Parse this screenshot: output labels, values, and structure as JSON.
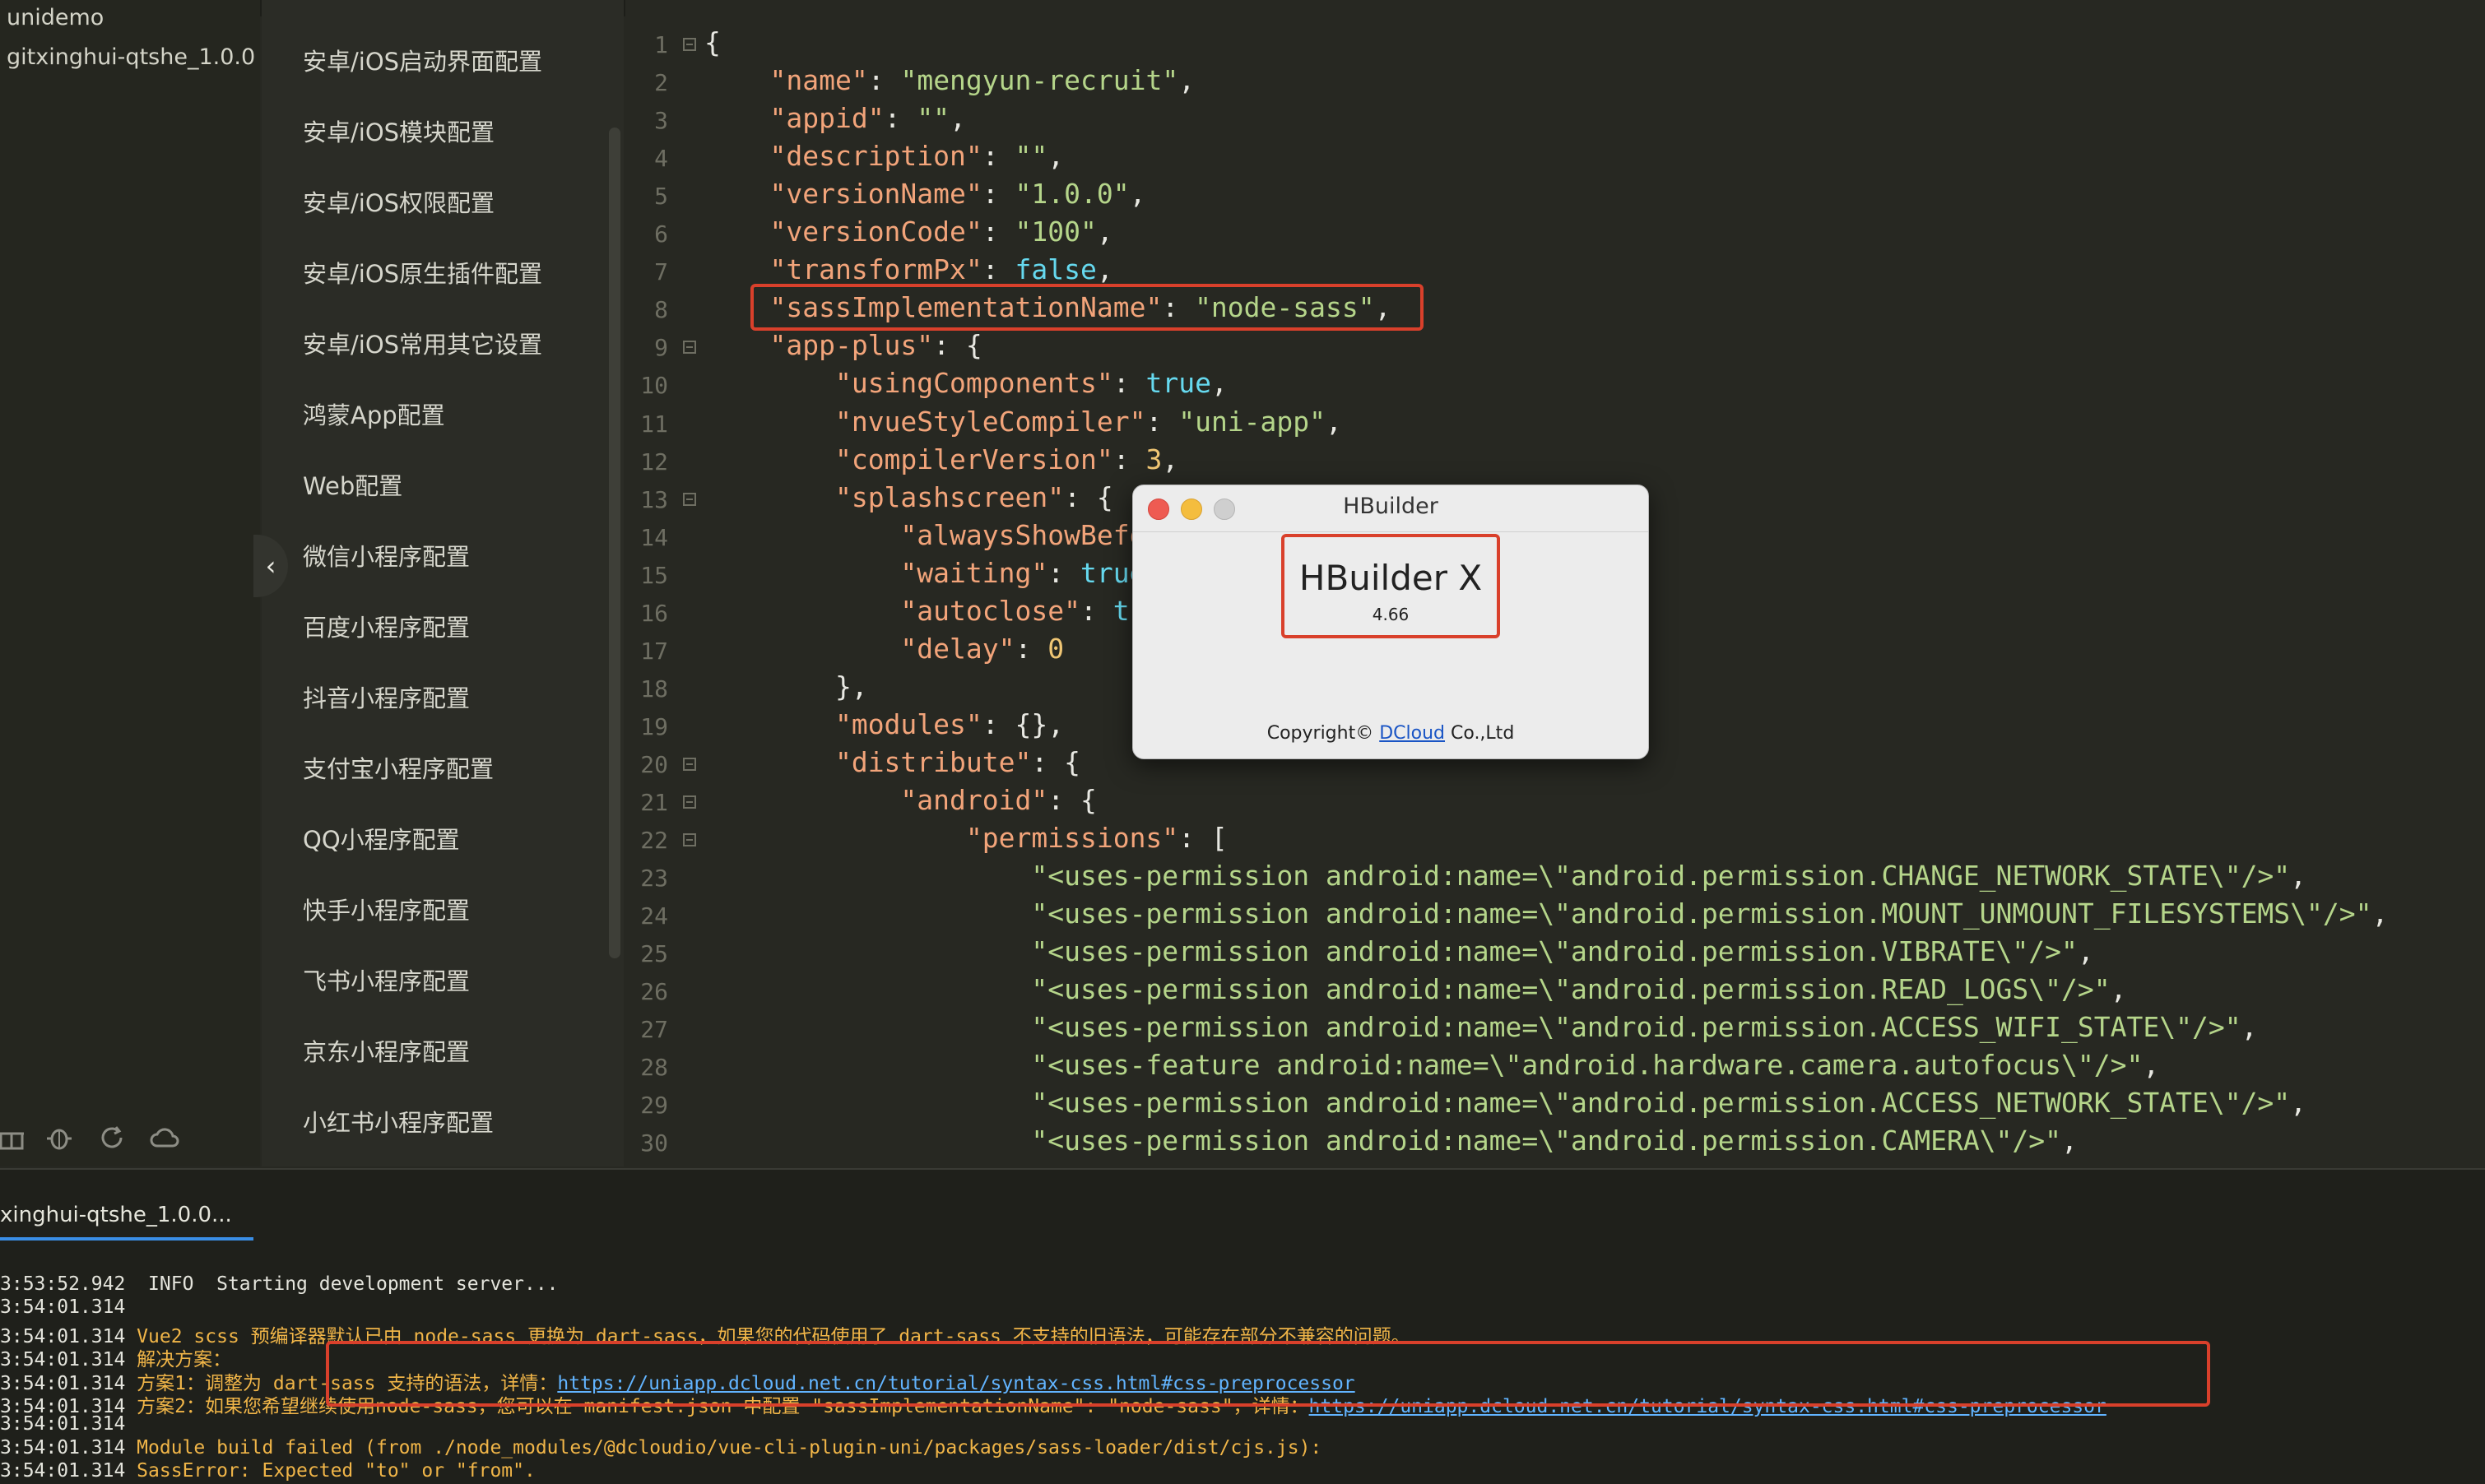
{
  "project_tree": {
    "projects": [
      "unidemo",
      "gitxinghui-qtshe_1.0.0"
    ],
    "toolbar_icons": [
      "gift-icon",
      "bug-icon",
      "refresh-icon",
      "cloud-icon"
    ]
  },
  "config_nav": {
    "items": [
      "安卓/iOS启动界面配置",
      "安卓/iOS模块配置",
      "安卓/iOS权限配置",
      "安卓/iOS原生插件配置",
      "安卓/iOS常用其它设置",
      "鸿蒙App配置",
      "Web配置",
      "微信小程序配置",
      "百度小程序配置",
      "抖音小程序配置",
      "支付宝小程序配置",
      "QQ小程序配置",
      "快手小程序配置",
      "飞书小程序配置",
      "京东小程序配置",
      "小红书小程序配置"
    ],
    "collapse_icon": "chevron-left-icon"
  },
  "editor": {
    "line_numbers": [
      "1",
      "2",
      "3",
      "4",
      "5",
      "6",
      "7",
      "8",
      "9",
      "10",
      "11",
      "12",
      "13",
      "14",
      "15",
      "16",
      "17",
      "18",
      "19",
      "20",
      "21",
      "22",
      "23",
      "24",
      "25",
      "26",
      "27",
      "28",
      "29",
      "30"
    ],
    "lines": [
      [
        {
          "t": "{",
          "c": "p"
        }
      ],
      [
        {
          "t": "    ",
          "c": "p"
        },
        {
          "t": "\"name\"",
          "c": "k"
        },
        {
          "t": ": ",
          "c": "p"
        },
        {
          "t": "\"mengyun-recruit\"",
          "c": "s"
        },
        {
          "t": ",",
          "c": "p"
        }
      ],
      [
        {
          "t": "    ",
          "c": "p"
        },
        {
          "t": "\"appid\"",
          "c": "k"
        },
        {
          "t": ": ",
          "c": "p"
        },
        {
          "t": "\"\"",
          "c": "s"
        },
        {
          "t": ",",
          "c": "p"
        }
      ],
      [
        {
          "t": "    ",
          "c": "p"
        },
        {
          "t": "\"description\"",
          "c": "k"
        },
        {
          "t": ": ",
          "c": "p"
        },
        {
          "t": "\"\"",
          "c": "s"
        },
        {
          "t": ",",
          "c": "p"
        }
      ],
      [
        {
          "t": "    ",
          "c": "p"
        },
        {
          "t": "\"versionName\"",
          "c": "k"
        },
        {
          "t": ": ",
          "c": "p"
        },
        {
          "t": "\"1.0.0\"",
          "c": "s"
        },
        {
          "t": ",",
          "c": "p"
        }
      ],
      [
        {
          "t": "    ",
          "c": "p"
        },
        {
          "t": "\"versionCode\"",
          "c": "k"
        },
        {
          "t": ": ",
          "c": "p"
        },
        {
          "t": "\"100\"",
          "c": "s"
        },
        {
          "t": ",",
          "c": "p"
        }
      ],
      [
        {
          "t": "    ",
          "c": "p"
        },
        {
          "t": "\"transformPx\"",
          "c": "k"
        },
        {
          "t": ": ",
          "c": "p"
        },
        {
          "t": "false",
          "c": "b"
        },
        {
          "t": ",",
          "c": "p"
        }
      ],
      [
        {
          "t": "    ",
          "c": "p"
        },
        {
          "t": "\"sassImplementationName\"",
          "c": "k"
        },
        {
          "t": ": ",
          "c": "p"
        },
        {
          "t": "\"node-sass\"",
          "c": "s"
        },
        {
          "t": ",",
          "c": "p"
        }
      ],
      [
        {
          "t": "    ",
          "c": "p"
        },
        {
          "t": "\"app-plus\"",
          "c": "k"
        },
        {
          "t": ": {",
          "c": "p"
        }
      ],
      [
        {
          "t": "        ",
          "c": "p"
        },
        {
          "t": "\"usingComponents\"",
          "c": "k"
        },
        {
          "t": ": ",
          "c": "p"
        },
        {
          "t": "true",
          "c": "b"
        },
        {
          "t": ",",
          "c": "p"
        }
      ],
      [
        {
          "t": "        ",
          "c": "p"
        },
        {
          "t": "\"nvueStyleCompiler\"",
          "c": "k"
        },
        {
          "t": ": ",
          "c": "p"
        },
        {
          "t": "\"uni-app\"",
          "c": "s"
        },
        {
          "t": ",",
          "c": "p"
        }
      ],
      [
        {
          "t": "        ",
          "c": "p"
        },
        {
          "t": "\"compilerVersion\"",
          "c": "k"
        },
        {
          "t": ": ",
          "c": "p"
        },
        {
          "t": "3",
          "c": "n"
        },
        {
          "t": ",",
          "c": "p"
        }
      ],
      [
        {
          "t": "        ",
          "c": "p"
        },
        {
          "t": "\"splashscreen\"",
          "c": "k"
        },
        {
          "t": ": {",
          "c": "p"
        }
      ],
      [
        {
          "t": "            ",
          "c": "p"
        },
        {
          "t": "\"alwaysShowBefo",
          "c": "k"
        }
      ],
      [
        {
          "t": "            ",
          "c": "p"
        },
        {
          "t": "\"waiting\"",
          "c": "k"
        },
        {
          "t": ": ",
          "c": "p"
        },
        {
          "t": "true",
          "c": "b"
        }
      ],
      [
        {
          "t": "            ",
          "c": "p"
        },
        {
          "t": "\"autoclose\"",
          "c": "k"
        },
        {
          "t": ": ",
          "c": "p"
        },
        {
          "t": "tr",
          "c": "b"
        }
      ],
      [
        {
          "t": "            ",
          "c": "p"
        },
        {
          "t": "\"delay\"",
          "c": "k"
        },
        {
          "t": ": ",
          "c": "p"
        },
        {
          "t": "0",
          "c": "n"
        }
      ],
      [
        {
          "t": "        },",
          "c": "p"
        }
      ],
      [
        {
          "t": "        ",
          "c": "p"
        },
        {
          "t": "\"modules\"",
          "c": "k"
        },
        {
          "t": ": {},",
          "c": "p"
        }
      ],
      [
        {
          "t": "        ",
          "c": "p"
        },
        {
          "t": "\"distribute\"",
          "c": "k"
        },
        {
          "t": ": {",
          "c": "p"
        }
      ],
      [
        {
          "t": "            ",
          "c": "p"
        },
        {
          "t": "\"android\"",
          "c": "k"
        },
        {
          "t": ": {",
          "c": "p"
        }
      ],
      [
        {
          "t": "                ",
          "c": "p"
        },
        {
          "t": "\"permissions\"",
          "c": "k"
        },
        {
          "t": ": [",
          "c": "p"
        }
      ],
      [
        {
          "t": "                    ",
          "c": "p"
        },
        {
          "t": "\"<uses-permission android:name=\\\"android.permission.CHANGE_NETWORK_STATE\\\"/>\"",
          "c": "s"
        },
        {
          "t": ",",
          "c": "p"
        }
      ],
      [
        {
          "t": "                    ",
          "c": "p"
        },
        {
          "t": "\"<uses-permission android:name=\\\"android.permission.MOUNT_UNMOUNT_FILESYSTEMS\\\"/>\"",
          "c": "s"
        },
        {
          "t": ",",
          "c": "p"
        }
      ],
      [
        {
          "t": "                    ",
          "c": "p"
        },
        {
          "t": "\"<uses-permission android:name=\\\"android.permission.VIBRATE\\\"/>\"",
          "c": "s"
        },
        {
          "t": ",",
          "c": "p"
        }
      ],
      [
        {
          "t": "                    ",
          "c": "p"
        },
        {
          "t": "\"<uses-permission android:name=\\\"android.permission.READ_LOGS\\\"/>\"",
          "c": "s"
        },
        {
          "t": ",",
          "c": "p"
        }
      ],
      [
        {
          "t": "                    ",
          "c": "p"
        },
        {
          "t": "\"<uses-permission android:name=\\\"android.permission.ACCESS_WIFI_STATE\\\"/>\"",
          "c": "s"
        },
        {
          "t": ",",
          "c": "p"
        }
      ],
      [
        {
          "t": "                    ",
          "c": "p"
        },
        {
          "t": "\"<uses-feature android:name=\\\"android.hardware.camera.autofocus\\\"/>\"",
          "c": "s"
        },
        {
          "t": ",",
          "c": "p"
        }
      ],
      [
        {
          "t": "                    ",
          "c": "p"
        },
        {
          "t": "\"<uses-permission android:name=\\\"android.permission.ACCESS_NETWORK_STATE\\\"/>\"",
          "c": "s"
        },
        {
          "t": ",",
          "c": "p"
        }
      ],
      [
        {
          "t": "                    ",
          "c": "p"
        },
        {
          "t": "\"<uses-permission android:name=\\\"android.permission.CAMERA\\\"/>\"",
          "c": "s"
        },
        {
          "t": ",",
          "c": "p"
        }
      ]
    ]
  },
  "about_dialog": {
    "title": "HBuilder",
    "product": "HBuilder X",
    "version": "4.66",
    "copyright_prefix": "Copyright© ",
    "copyright_link": "DCloud",
    "copyright_suffix": " Co.,Ltd"
  },
  "console": {
    "tab_label": "xinghui-qtshe_1.0.0...",
    "logs": [
      {
        "ts": "3:53:52.942",
        "text": "  INFO  Starting development server...",
        "warn": false
      },
      {
        "ts": "3:54:01.314",
        "text": "",
        "warn": false
      },
      {
        "ts": "3:54:01.314",
        "text": " Vue2 scss 预编译器默认已由 node-sass 更换为 dart-sass，如果您的代码使用了 dart-sass 不支持的旧语法，可能存在部分不兼容的问题。",
        "warn": true
      },
      {
        "ts": "3:54:01.314",
        "text": " 解决方案：",
        "warn": true
      },
      {
        "ts": "3:54:01.314",
        "text": " 方案1：调整为 dart-sass 支持的语法，详情：",
        "warn": true,
        "link": "https://uniapp.dcloud.net.cn/tutorial/syntax-css.html#css-preprocessor"
      },
      {
        "ts": "3:54:01.314",
        "text": " 方案2：如果您希望继续使用node-sass，您可以在 manifest.json 中配置 \"sassImplementationName\": \"node-sass\"，详情：",
        "warn": true,
        "link": "https://uniapp.dcloud.net.cn/tutorial/syntax-css.html#css-preprocessor"
      },
      {
        "ts": "3:54:01.314",
        "text": "",
        "warn": false
      },
      {
        "ts": "3:54:01.314",
        "text": " Module build failed (from ./node_modules/@dcloudio/vue-cli-plugin-uni/packages/sass-loader/dist/cjs.js):",
        "warn": true
      },
      {
        "ts": "3:54:01.314",
        "text": " SassError: Expected \"to\" or \"from\".",
        "warn": true
      }
    ]
  },
  "colors": {
    "highlight_box": "#d9402b",
    "close_light": "#ee5b52",
    "minimize_light": "#f4bd3e",
    "zoom_light": "#cfcfcf"
  }
}
